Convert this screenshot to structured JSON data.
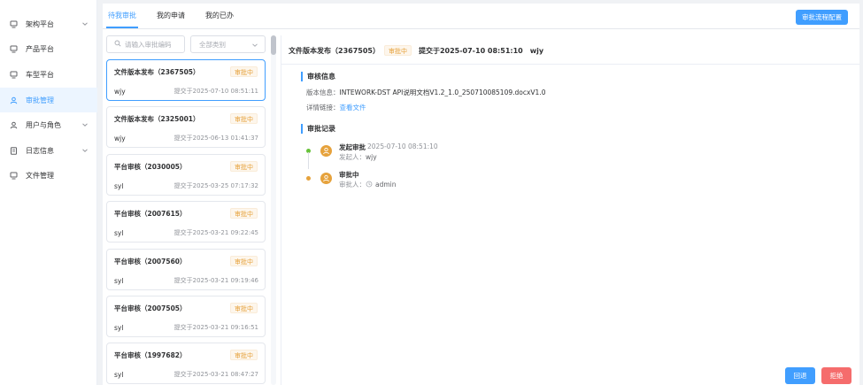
{
  "sidebar": {
    "items": [
      {
        "label": "架构平台",
        "icon": "monitor-icon",
        "has_children": true
      },
      {
        "label": "产品平台",
        "icon": "monitor-icon",
        "has_children": false
      },
      {
        "label": "车型平台",
        "icon": "monitor-icon",
        "has_children": false
      },
      {
        "label": "审批管理",
        "icon": "user-icon",
        "has_children": false,
        "active": true
      },
      {
        "label": "用户与角色",
        "icon": "user-icon",
        "has_children": true
      },
      {
        "label": "日志信息",
        "icon": "document-icon",
        "has_children": true
      },
      {
        "label": "文件管理",
        "icon": "monitor-icon",
        "has_children": false
      }
    ]
  },
  "tabs": [
    {
      "label": "待我审批",
      "active": true
    },
    {
      "label": "我的申请",
      "active": false
    },
    {
      "label": "我的已办",
      "active": false
    }
  ],
  "config_button": "审批流程配置",
  "search": {
    "placeholder": "请输入审批编码",
    "value": ""
  },
  "category_select": {
    "value": "全部类别"
  },
  "list": [
    {
      "title": "文件版本发布（2367505）",
      "status": "审批中",
      "user": "wjy",
      "time": "提交于2025-07-10 08:51:11",
      "selected": true
    },
    {
      "title": "文件版本发布（2325001）",
      "status": "审批中",
      "user": "wjy",
      "time": "提交于2025-06-13 01:41:37"
    },
    {
      "title": "平台审核（2030005）",
      "status": "审批中",
      "user": "syl",
      "time": "提交于2025-03-25 07:17:32"
    },
    {
      "title": "平台审核（2007615）",
      "status": "审批中",
      "user": "syl",
      "time": "提交于2025-03-21 09:22:45"
    },
    {
      "title": "平台审核（2007560）",
      "status": "审批中",
      "user": "syl",
      "time": "提交于2025-03-21 09:19:46"
    },
    {
      "title": "平台审核（2007505）",
      "status": "审批中",
      "user": "syl",
      "time": "提交于2025-03-21 09:16:51"
    },
    {
      "title": "平台审核（1997682）",
      "status": "审批中",
      "user": "syl",
      "time": "提交于2025-03-21 08:47:27"
    }
  ],
  "detail": {
    "title": "文件版本发布（2367505）",
    "status": "审批中",
    "submitted": "提交于2025-07-10 08:51:10",
    "user": "wjy",
    "info_section": "审核信息",
    "version_label": "版本信息：",
    "version_value": "INTEWORK-DST API说明文档V1.2_1.0_250710085109.docxV1.0",
    "link_label": "详情链接：",
    "link_text": "查看文件",
    "record_section": "审批记录",
    "records": [
      {
        "title": "发起审批",
        "time": "2025-07-10 08:51:10",
        "sub_label": "发起人：",
        "sub_value": "wjy",
        "dot_color": "#67c23a"
      },
      {
        "title": "审批中",
        "time": "",
        "sub_label": "审批人：",
        "sub_value": "admin",
        "dot_color": "#e6a23c"
      }
    ]
  },
  "actions": {
    "return_label": "回退",
    "reject_label": "拒绝"
  },
  "colors": {
    "primary": "#409eff",
    "warning": "#e6a23c",
    "danger": "#f56c6c",
    "success": "#67c23a"
  }
}
